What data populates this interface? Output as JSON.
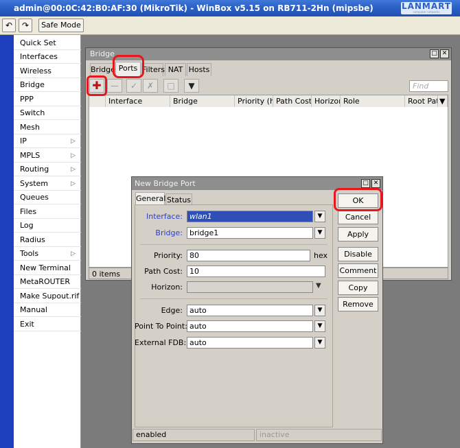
{
  "window": {
    "title": "admin@00:0C:42:B0:AF:30 (MikroTik) - WinBox v5.15 on RB711-2Hn (mipsbe)"
  },
  "logo": {
    "text": "LANMART",
    "tagline": "computer networks"
  },
  "toolbar": {
    "undo_glyph": "↶",
    "redo_glyph": "↷",
    "safe_mode_label": "Safe Mode"
  },
  "sidebar": {
    "items": [
      {
        "label": "Quick Set",
        "submenu": false
      },
      {
        "label": "Interfaces",
        "submenu": false
      },
      {
        "label": "Wireless",
        "submenu": false
      },
      {
        "label": "Bridge",
        "submenu": false
      },
      {
        "label": "PPP",
        "submenu": false
      },
      {
        "label": "Switch",
        "submenu": false
      },
      {
        "label": "Mesh",
        "submenu": false
      },
      {
        "label": "IP",
        "submenu": true
      },
      {
        "label": "MPLS",
        "submenu": true
      },
      {
        "label": "Routing",
        "submenu": true
      },
      {
        "label": "System",
        "submenu": true
      },
      {
        "label": "Queues",
        "submenu": false
      },
      {
        "label": "Files",
        "submenu": false
      },
      {
        "label": "Log",
        "submenu": false
      },
      {
        "label": "Radius",
        "submenu": false
      },
      {
        "label": "Tools",
        "submenu": true
      },
      {
        "label": "New Terminal",
        "submenu": false
      },
      {
        "label": "MetaROUTER",
        "submenu": false
      },
      {
        "label": "Make Supout.rif",
        "submenu": false
      },
      {
        "label": "Manual",
        "submenu": false
      },
      {
        "label": "Exit",
        "submenu": false
      }
    ]
  },
  "bridge_window": {
    "title": "Bridge",
    "tabs": [
      "Bridge",
      "Ports",
      "Filters",
      "NAT",
      "Hosts"
    ],
    "active_tab": "Ports",
    "find_placeholder": "Find",
    "columns": [
      "Interface",
      "Bridge",
      "Priority (h...",
      "Path Cost",
      "Horizon",
      "Role",
      "Root Pat..."
    ],
    "item_count": "0 items"
  },
  "dialog": {
    "title": "New Bridge Port",
    "tabs": [
      "General",
      "Status"
    ],
    "active_tab": "General",
    "fields": {
      "interface": {
        "label": "Interface:",
        "value": "wlan1"
      },
      "bridge": {
        "label": "Bridge:",
        "value": "bridge1"
      },
      "priority": {
        "label": "Priority:",
        "value": "80",
        "unit": "hex"
      },
      "path_cost": {
        "label": "Path Cost:",
        "value": "10"
      },
      "horizon": {
        "label": "Horizon:",
        "value": ""
      },
      "edge": {
        "label": "Edge:",
        "value": "auto"
      },
      "point_to_point": {
        "label": "Point To Point:",
        "value": "auto"
      },
      "external_fdb": {
        "label": "External FDB:",
        "value": "auto"
      }
    },
    "buttons": [
      "OK",
      "Cancel",
      "Apply",
      "Disable",
      "Comment",
      "Copy",
      "Remove"
    ],
    "status_left": "enabled",
    "status_right": "inactive"
  },
  "colors": {
    "highlight": "#e8171e",
    "sidebar_strip": "#1e3fbd",
    "titlebar": "#2a5fc4"
  }
}
